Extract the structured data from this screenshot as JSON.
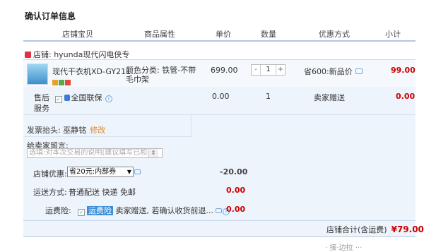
{
  "title": "确认订单信息",
  "columns": [
    "店铺宝贝",
    "商品属性",
    "单价",
    "数量",
    "优惠方式",
    "小计"
  ],
  "shop": {
    "label": "店铺: hyunda现代闪电侠专"
  },
  "item": {
    "title": "现代干衣机XD-GY211...",
    "property": "颜色分类: 铁管-不带毛巾架",
    "price": "699.00",
    "quantity": "1",
    "minus": "-",
    "plus": "+",
    "discount": "省600:新品价",
    "subtotal": "99.00"
  },
  "service": {
    "label_prefix": "售后",
    "option": "全国联保",
    "label_suffix": "服务",
    "price": "0.00",
    "quantity": "1",
    "discount": "卖家赠送",
    "subtotal": "0.00"
  },
  "invoice": {
    "label": "发票抬头: 巫静铭",
    "edit": "修改"
  },
  "message": {
    "label": "给卖家留言:",
    "placeholder": "选填:对本次交易的说明(建议填写已和"
  },
  "coupon": {
    "label": "店铺优惠:",
    "selected": "省20元:内部券",
    "amount": "-20.00"
  },
  "shipping": {
    "label": "运送方式:",
    "value": "普通配送 快递 免邮",
    "amount": "0.00"
  },
  "insurance": {
    "label": "运费险:",
    "highlight": "运费险",
    "text": "卖家赠送, 若确认收货前退...",
    "amount": "0.00"
  },
  "total": {
    "label": "店铺合计(含运费)",
    "value": "¥79.00"
  },
  "footer_cut": "· 接·边拉    ···"
}
